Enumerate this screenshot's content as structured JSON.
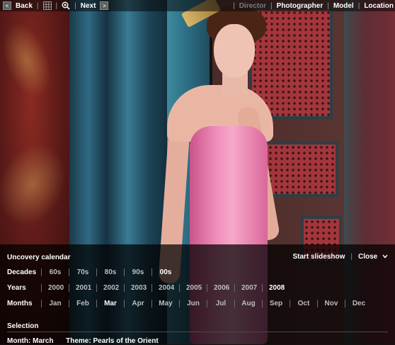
{
  "toolbar": {
    "back_label": "Back",
    "next_label": "Next",
    "sep": "|",
    "right_menu": [
      {
        "label": "Director",
        "dim": true
      },
      {
        "label": "Photographer",
        "dim": false
      },
      {
        "label": "Model",
        "dim": false
      },
      {
        "label": "Location",
        "dim": false
      }
    ]
  },
  "calendar": {
    "title": "Uncovery calendar",
    "start_slideshow": "Start slideshow",
    "close": "Close",
    "decades": {
      "label": "Decades",
      "options": [
        "60s",
        "70s",
        "80s",
        "90s",
        "00s"
      ],
      "selected": "00s"
    },
    "years": {
      "label": "Years",
      "options": [
        "2000",
        "2001",
        "2002",
        "2003",
        "2004",
        "2005",
        "2006",
        "2007",
        "2008"
      ],
      "selected": "2008"
    },
    "months": {
      "label": "Months",
      "options": [
        "Jan",
        "Feb",
        "Mar",
        "Apr",
        "May",
        "Jun",
        "Jul",
        "Aug",
        "Sep",
        "Oct",
        "Nov",
        "Dec"
      ],
      "selected": "Mar"
    }
  },
  "selection": {
    "title": "Selection",
    "month_label": "Month:",
    "month_value": "March",
    "theme_label": "Theme:",
    "theme_value": "Pearls of the Orient"
  },
  "colors": {
    "toolbar_bg": "#0a0a0a",
    "panel_bg": "#000000",
    "inactive_text": "#bdbdbd",
    "active_text": "#ffffff"
  }
}
